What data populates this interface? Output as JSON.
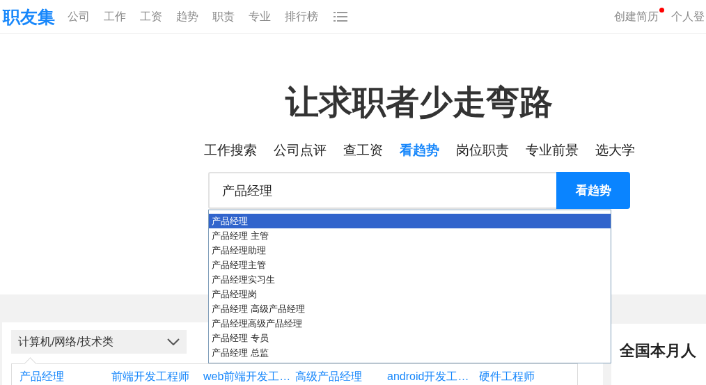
{
  "header": {
    "logo": "职友集",
    "nav": [
      "公司",
      "工作",
      "工资",
      "趋势",
      "职责",
      "专业",
      "排行榜"
    ],
    "right_links": [
      {
        "label": "创建简历",
        "badge_dot": true
      },
      {
        "label": "个人登",
        "badge_dot": false
      }
    ]
  },
  "hero": {
    "title": "让求职者少走弯路",
    "tabs": [
      {
        "label": "工作搜索",
        "selected": false
      },
      {
        "label": "公司点评",
        "selected": false
      },
      {
        "label": "查工资",
        "selected": false
      },
      {
        "label": "看趋势",
        "selected": true
      },
      {
        "label": "岗位职责",
        "selected": false
      },
      {
        "label": "专业前景",
        "selected": false
      },
      {
        "label": "选大学",
        "selected": false
      }
    ],
    "search": {
      "value": "产品经理",
      "button": "看趋势"
    },
    "suggestions": [
      {
        "label": "产品经理",
        "selected": true
      },
      {
        "label": "产品经理 主管",
        "selected": false
      },
      {
        "label": "产品经理助理",
        "selected": false
      },
      {
        "label": "产品经理主管",
        "selected": false
      },
      {
        "label": "产品经理实习生",
        "selected": false
      },
      {
        "label": "产品经理岗",
        "selected": false
      },
      {
        "label": "产品经理 高级产品经理",
        "selected": false
      },
      {
        "label": "产品经理高级产品经理",
        "selected": false
      },
      {
        "label": "产品经理 专员",
        "selected": false
      },
      {
        "label": "产品经理 总监",
        "selected": false
      }
    ]
  },
  "category_panel": {
    "category_select": "计算机/网络/技术类",
    "jobs": [
      "产品经理",
      "前端开发工程师",
      "web前端开发工…",
      "高级产品经理",
      "android开发工…",
      "硬件工程师"
    ]
  },
  "side_panel": {
    "title": "全国本月人"
  }
}
